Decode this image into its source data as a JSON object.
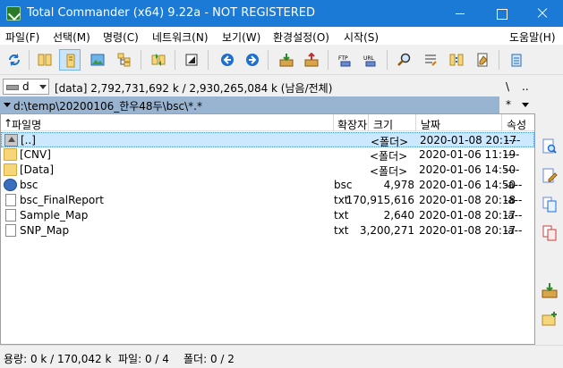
{
  "window": {
    "title": "Total Commander (x64) 9.22a - NOT REGISTERED"
  },
  "menu": [
    "파일(F)",
    "선택(M)",
    "명령(C)",
    "네트워크(N)",
    "보기(W)",
    "환경설정(O)",
    "시작(S)",
    "도움말(H)"
  ],
  "drive": {
    "letter": "d",
    "info": "[data]  2,792,731,692 k / 2,930,265,084 k (남음/전체)",
    "root_button": "\\",
    "parent_button": ".."
  },
  "path": {
    "text": "d:\\temp\\20200106_한우48두\\bsc\\*.*",
    "history_button": "*",
    "dropdown_icon": "caret-down-icon"
  },
  "columns": {
    "sort_arrow": "↑",
    "name": "파일명",
    "ext": "확장자",
    "size": "크기",
    "date": "날짜",
    "attr": "속성"
  },
  "files": [
    {
      "icon": "up-folder-icon",
      "name": "[..]",
      "ext": "",
      "size": "<폴더>",
      "date": "2020-01-08 20:17",
      "attr": "----",
      "selected": true
    },
    {
      "icon": "folder-icon",
      "name": "[CNV]",
      "ext": "",
      "size": "<폴더>",
      "date": "2020-01-06 11:19",
      "attr": "----"
    },
    {
      "icon": "folder-icon",
      "name": "[Data]",
      "ext": "",
      "size": "<폴더>",
      "date": "2020-01-06 14:50",
      "attr": "----"
    },
    {
      "icon": "bsc-file-icon",
      "name": "bsc",
      "ext": "bsc",
      "size": "4,978",
      "date": "2020-01-06 14:50",
      "attr": "-a--"
    },
    {
      "icon": "text-file-icon",
      "name": "bsc_FinalReport",
      "ext": "txt",
      "size": "170,915,616",
      "date": "2020-01-08 20:18",
      "attr": "-a--"
    },
    {
      "icon": "text-file-icon",
      "name": "Sample_Map",
      "ext": "txt",
      "size": "2,640",
      "date": "2020-01-08 20:17",
      "attr": "-a--"
    },
    {
      "icon": "text-file-icon",
      "name": "SNP_Map",
      "ext": "txt",
      "size": "3,200,271",
      "date": "2020-01-08 20:17",
      "attr": "-a--"
    }
  ],
  "toolbar_icons": [
    "refresh-icon",
    "brief-view-icon",
    "full-view-icon",
    "thumbnail-view-icon",
    "tree-view-icon",
    "compare-dirs-icon",
    "invert-selection-icon",
    "back-icon",
    "forward-icon",
    "pack-icon",
    "unpack-icon",
    "ftp-icon",
    "url-icon",
    "search-icon",
    "multi-rename-icon",
    "sync-dirs-icon",
    "notepad-icon",
    "clipboard-icon"
  ],
  "sidebar_icons": [
    "quick-view-icon",
    "edit-icon",
    "copy-icon",
    "move-icon",
    "pack-icon",
    "new-folder-icon"
  ],
  "status": {
    "size": "용량: 0 k / 170,042 k",
    "files": "파일: 0 / 4",
    "folders": "폴더: 0 / 2"
  },
  "colors": {
    "titlebar": "#1a7ad6",
    "path_bar": "#99b4d1",
    "selection": "#cce8ff"
  }
}
